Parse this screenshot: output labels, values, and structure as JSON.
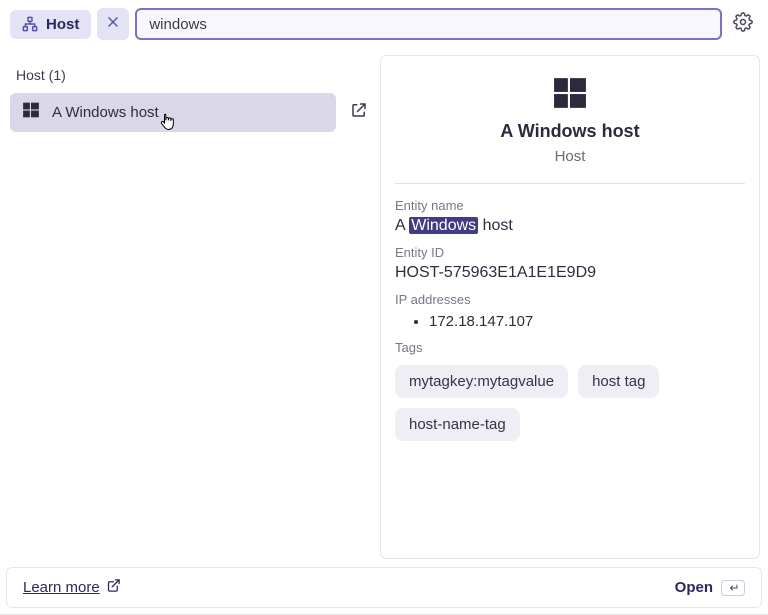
{
  "topbar": {
    "filter_chip_label": "Host",
    "search_value": "windows"
  },
  "left": {
    "section_header": "Host (1)",
    "results": [
      {
        "label": "A Windows host"
      }
    ]
  },
  "detail": {
    "title": "A Windows host",
    "subtitle": "Host",
    "entity_name_label": "Entity name",
    "entity_name_prefix": "A ",
    "entity_name_highlight": "Windows",
    "entity_name_suffix": " host",
    "entity_id_label": "Entity ID",
    "entity_id_value": "HOST-575963E1A1E1E9D9",
    "ip_label": "IP addresses",
    "ips": [
      "172.18.147.107"
    ],
    "tags_label": "Tags",
    "tags": [
      "mytagkey:mytagvalue",
      "host tag",
      "host-name-tag"
    ]
  },
  "footer": {
    "learn_more": "Learn more",
    "open": "Open"
  }
}
